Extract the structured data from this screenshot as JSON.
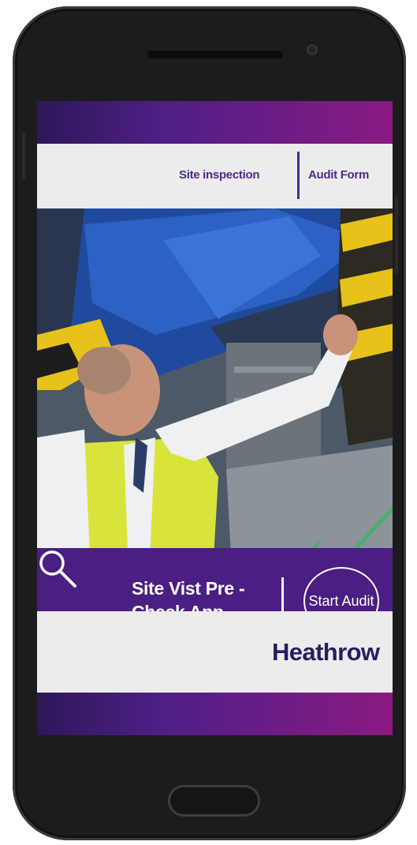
{
  "nav": {
    "site_inspection": "Site inspection",
    "audit_form": "Audit Form"
  },
  "hero": {
    "image_description_icon": "worker-inspecting-equipment-photo"
  },
  "cta": {
    "title": "Site Vist Pre - Check App",
    "start_button": "Start Audit",
    "icon": "search-icon"
  },
  "brand": {
    "logo_text": "Heathrow"
  },
  "colors": {
    "brand_purple": "#4a1e82",
    "gradient_start": "#2e1759",
    "gradient_end": "#8a1a7f",
    "nav_text": "#4b2a8a",
    "logo_text": "#2e1a63"
  }
}
